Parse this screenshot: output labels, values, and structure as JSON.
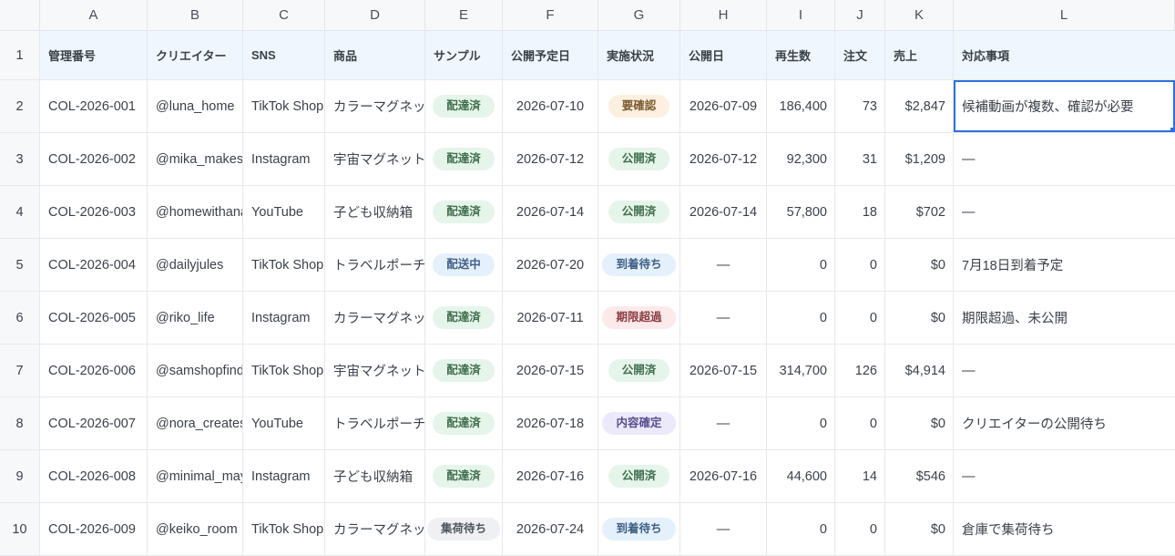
{
  "columns": [
    "A",
    "B",
    "C",
    "D",
    "E",
    "F",
    "G",
    "H",
    "I",
    "J",
    "K",
    "L"
  ],
  "header": {
    "row_num": "1",
    "id": "管理番号",
    "creator": "クリエイター",
    "sns": "SNS",
    "product": "商品",
    "sample": "サンプル",
    "planned": "公開予定日",
    "status": "実施状況",
    "published": "公開日",
    "views": "再生数",
    "orders": "注文",
    "sales": "売上",
    "action": "対応事項"
  },
  "rows": [
    {
      "n": "2",
      "id": "COL-2026-001",
      "creator": "@luna_home",
      "sns": "TikTok Shop",
      "product": "カラーマグネット",
      "sample": "配達済",
      "sample_style": "delivered",
      "planned": "2026-07-10",
      "status": "要確認",
      "status_style": "confirm",
      "published": "2026-07-09",
      "views": "186,400",
      "orders": "73",
      "sales": "$2,847",
      "action": "候補動画が複数、確認が必要"
    },
    {
      "n": "3",
      "id": "COL-2026-002",
      "creator": "@mika_makes",
      "sns": "Instagram",
      "product": "宇宙マグネット",
      "sample": "配達済",
      "sample_style": "delivered",
      "planned": "2026-07-12",
      "status": "公開済",
      "status_style": "published",
      "published": "2026-07-12",
      "views": "92,300",
      "orders": "31",
      "sales": "$1,209",
      "action": "—"
    },
    {
      "n": "4",
      "id": "COL-2026-003",
      "creator": "@homewithana",
      "sns": "YouTube",
      "product": "子ども収納箱",
      "sample": "配達済",
      "sample_style": "delivered",
      "planned": "2026-07-14",
      "status": "公開済",
      "status_style": "published",
      "published": "2026-07-14",
      "views": "57,800",
      "orders": "18",
      "sales": "$702",
      "action": "—"
    },
    {
      "n": "5",
      "id": "COL-2026-004",
      "creator": "@dailyjules",
      "sns": "TikTok Shop",
      "product": "トラベルポーチ",
      "sample": "配送中",
      "sample_style": "shipping",
      "planned": "2026-07-20",
      "status": "到着待ち",
      "status_style": "arrive",
      "published": "—",
      "views": "0",
      "orders": "0",
      "sales": "$0",
      "action": "7月18日到着予定"
    },
    {
      "n": "6",
      "id": "COL-2026-005",
      "creator": "@riko_life",
      "sns": "Instagram",
      "product": "カラーマグネット",
      "sample": "配達済",
      "sample_style": "delivered",
      "planned": "2026-07-11",
      "status": "期限超過",
      "status_style": "overdue",
      "published": "—",
      "views": "0",
      "orders": "0",
      "sales": "$0",
      "action": "期限超過、未公開"
    },
    {
      "n": "7",
      "id": "COL-2026-006",
      "creator": "@samshopfinds",
      "sns": "TikTok Shop",
      "product": "宇宙マグネット",
      "sample": "配達済",
      "sample_style": "delivered",
      "planned": "2026-07-15",
      "status": "公開済",
      "status_style": "published",
      "published": "2026-07-15",
      "views": "314,700",
      "orders": "126",
      "sales": "$4,914",
      "action": "—"
    },
    {
      "n": "8",
      "id": "COL-2026-007",
      "creator": "@nora_creates",
      "sns": "YouTube",
      "product": "トラベルポーチ",
      "sample": "配達済",
      "sample_style": "delivered",
      "planned": "2026-07-18",
      "status": "内容確定",
      "status_style": "content",
      "published": "—",
      "views": "0",
      "orders": "0",
      "sales": "$0",
      "action": "クリエイターの公開待ち"
    },
    {
      "n": "9",
      "id": "COL-2026-008",
      "creator": "@minimal_may",
      "sns": "Instagram",
      "product": "子ども収納箱",
      "sample": "配達済",
      "sample_style": "delivered",
      "planned": "2026-07-16",
      "status": "公開済",
      "status_style": "published",
      "published": "2026-07-16",
      "views": "44,600",
      "orders": "14",
      "sales": "$546",
      "action": "—"
    },
    {
      "n": "10",
      "id": "COL-2026-009",
      "creator": "@keiko_room",
      "sns": "TikTok Shop",
      "product": "カラーマグネット",
      "sample": "集荷待ち",
      "sample_style": "waiting",
      "planned": "2026-07-24",
      "status": "到着待ち",
      "status_style": "arrive",
      "published": "—",
      "views": "0",
      "orders": "0",
      "sales": "$0",
      "action": "倉庫で集荷待ち"
    }
  ],
  "selected_cell": "L2",
  "colors": {
    "accent": "#2f6fdc",
    "header_bg": "#f0f6fd"
  }
}
